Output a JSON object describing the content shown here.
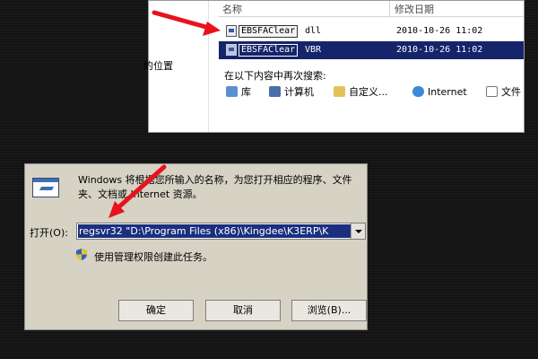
{
  "explorer": {
    "left_pane_text": "的位置",
    "columns": {
      "name": "名称",
      "modified": "修改日期"
    },
    "files": [
      {
        "name": "EBSFAClear",
        "type": "dll",
        "date": "2010-10-26 11:02"
      },
      {
        "name": "EBSFAClear",
        "type": "VBR",
        "date": "2010-10-26 11:02"
      }
    ],
    "search_again": "在以下内容中再次搜索:",
    "locations": [
      {
        "label": "库",
        "icon": "library-icon"
      },
      {
        "label": "计算机",
        "icon": "computer-icon"
      },
      {
        "label": "自定义...",
        "icon": "folder-icon"
      },
      {
        "label": "Internet",
        "icon": "internet-icon"
      },
      {
        "label": "文件",
        "icon": "file-search-icon"
      }
    ]
  },
  "run": {
    "description": "Windows 将根据您所输入的名称，为您打开相应的程序、文件夹、文档或 Internet 资源。",
    "open_label": "打开(O):",
    "command": "regsvr32  \"D:\\Program Files (x86)\\Kingdee\\K3ERP\\K",
    "admin_note": "使用管理权限创建此任务。",
    "buttons": {
      "ok": "确定",
      "cancel": "取消",
      "browse": "浏览(B)..."
    }
  },
  "colors": {
    "selection": "#16246b",
    "dialog_bg": "#d6d2c4",
    "arrow": "#e8121d"
  }
}
